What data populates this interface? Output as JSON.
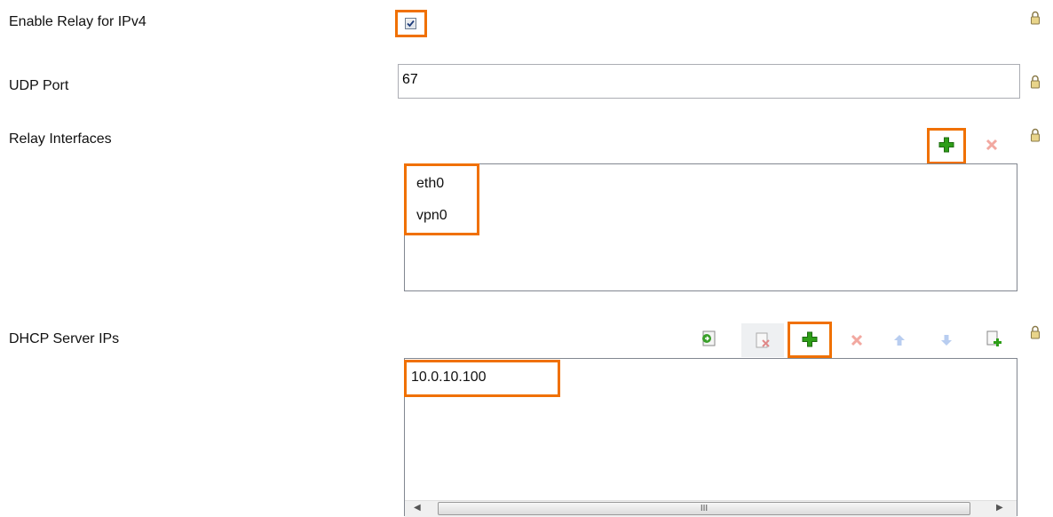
{
  "fields": {
    "enable_relay": {
      "label": "Enable Relay for IPv4",
      "checked": true
    },
    "udp_port": {
      "label": "UDP Port",
      "value": "67"
    },
    "relay_interfaces": {
      "label": "Relay Interfaces",
      "items": [
        "eth0",
        "vpn0"
      ]
    },
    "dhcp_server_ips": {
      "label": "DHCP Server IPs",
      "items": [
        "10.0.10.100"
      ]
    }
  },
  "scrollbar": {
    "grip": "III"
  },
  "colors": {
    "highlight": "#f07000",
    "add_green": "#2e9e18",
    "delete_red": "#e06060",
    "arrow_blue": "#7ea6e6"
  }
}
